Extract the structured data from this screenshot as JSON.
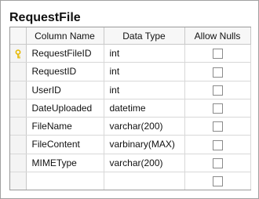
{
  "table_title": "RequestFile",
  "columns": {
    "col1": "Column Name",
    "col2": "Data Type",
    "col3": "Allow Nulls"
  },
  "rows": [
    {
      "name": "RequestFileID",
      "type": "int",
      "allow_nulls": false,
      "primary_key": true
    },
    {
      "name": "RequestID",
      "type": "int",
      "allow_nulls": false,
      "primary_key": false
    },
    {
      "name": "UserID",
      "type": "int",
      "allow_nulls": false,
      "primary_key": false
    },
    {
      "name": "DateUploaded",
      "type": "datetime",
      "allow_nulls": false,
      "primary_key": false
    },
    {
      "name": "FileName",
      "type": "varchar(200)",
      "allow_nulls": false,
      "primary_key": false
    },
    {
      "name": "FileContent",
      "type": "varbinary(MAX)",
      "allow_nulls": false,
      "primary_key": false
    },
    {
      "name": "MIMEType",
      "type": "varchar(200)",
      "allow_nulls": false,
      "primary_key": false
    },
    {
      "name": "",
      "type": "",
      "allow_nulls": false,
      "primary_key": false
    }
  ],
  "colors": {
    "key_gold": "#e6b800",
    "border": "#9a9a9a"
  },
  "icons": {
    "primary_key": "key-icon"
  }
}
